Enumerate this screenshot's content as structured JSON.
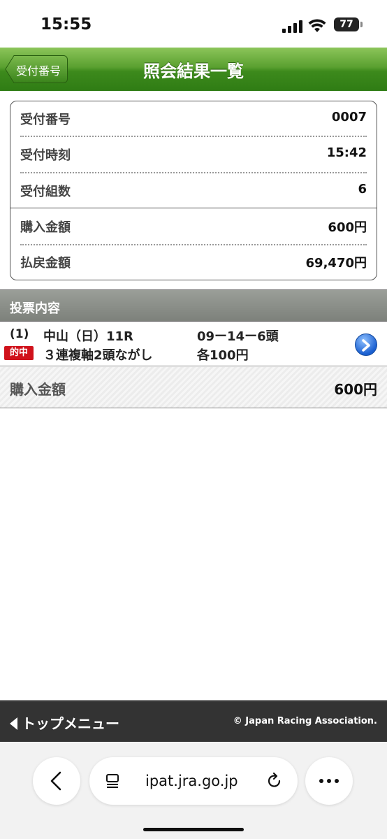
{
  "status": {
    "time": "15:55",
    "battery": "77"
  },
  "header": {
    "back_label": "受付番号",
    "title": "照会結果一覧"
  },
  "summary": {
    "rows": [
      {
        "label": "受付番号",
        "value": "0007"
      },
      {
        "label": "受付時刻",
        "value": "15:42"
      },
      {
        "label": "受付組数",
        "value": "6"
      },
      {
        "label": "購入金額",
        "value": "600円"
      },
      {
        "label": "払戻金額",
        "value": "69,470円"
      }
    ]
  },
  "votes": {
    "header": "投票内容",
    "items": [
      {
        "number": "(1)",
        "venue": "中山（日）11R",
        "combination": "09ー14ー6頭",
        "hit_badge": "的中",
        "bet_type": "３連複軸2頭ながし",
        "amount": "各100円"
      }
    ],
    "total_label": "購入金額",
    "total_value": "600円"
  },
  "footer": {
    "menu_label": "トップメニュー",
    "copyright": "© Japan Racing Association."
  },
  "browser": {
    "url": "ipat.jra.go.jp"
  },
  "colors": {
    "header_green": "#3d8a1c",
    "hit_red": "#d0121b",
    "footer_dark": "#333333"
  }
}
